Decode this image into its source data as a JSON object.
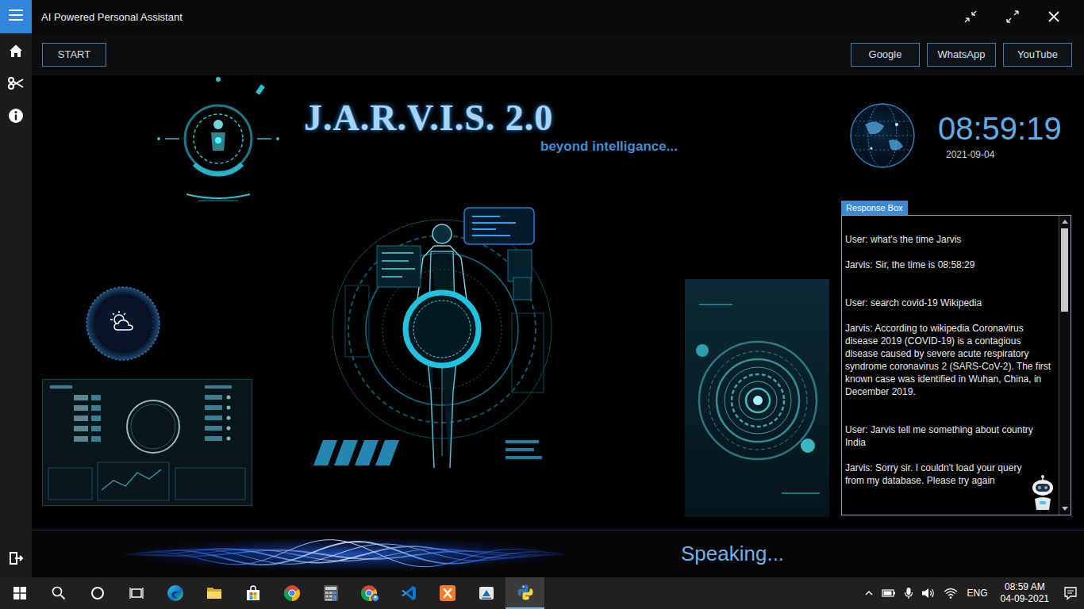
{
  "window": {
    "title": "AI Powered Personal Assistant"
  },
  "toolbar": {
    "start": "START",
    "links": [
      "Google",
      "WhatsApp",
      "YouTube"
    ]
  },
  "header": {
    "title": "J.A.R.V.I.S. 2.0",
    "tagline": "beyond intelligance..."
  },
  "clock": {
    "time": "08:59:19",
    "date": "2021-09-04"
  },
  "response_box": {
    "label": "Response Box",
    "messages": [
      {
        "kind": "user",
        "text": "User: what's the time Jarvis"
      },
      {
        "kind": "jarvis",
        "text": "Jarvis: Sir, the time is 08:58:29"
      },
      {
        "kind": "user",
        "text": "User: search covid-19 Wikipedia"
      },
      {
        "kind": "jarvis",
        "text": "Jarvis: According to wikipedia Coronavirus disease 2019 (COVID-19) is a contagious disease caused by severe acute respiratory syndrome coronavirus 2 (SARS-CoV-2). The first known case was identified in Wuhan, China, in December 2019."
      },
      {
        "kind": "user",
        "text": "User: Jarvis tell me something about country India"
      },
      {
        "kind": "jarvis",
        "text": "Jarvis: Sorry sir. I couldn't load your query from my database. Please try again"
      }
    ]
  },
  "status": {
    "text": "Speaking..."
  },
  "taskbar": {
    "buttons": [
      {
        "kind": "start"
      },
      {
        "kind": "search"
      },
      {
        "kind": "cortana"
      },
      {
        "kind": "taskview"
      }
    ],
    "apps": [
      {
        "kind": "edge",
        "selected": false
      },
      {
        "kind": "explorer",
        "selected": false
      },
      {
        "kind": "store",
        "selected": false
      },
      {
        "kind": "chrome",
        "selected": false
      },
      {
        "kind": "calculator",
        "selected": false
      },
      {
        "kind": "chromeprofile",
        "selected": false
      },
      {
        "kind": "vscode",
        "selected": false
      },
      {
        "kind": "xampp",
        "selected": false
      },
      {
        "kind": "installer",
        "selected": false
      },
      {
        "kind": "python",
        "selected": true
      }
    ],
    "tray": {
      "icons": [
        {
          "kind": "chevron"
        },
        {
          "kind": "battery"
        },
        {
          "kind": "mic"
        },
        {
          "kind": "volume"
        },
        {
          "kind": "wifi"
        }
      ],
      "language": "ENG",
      "time": "08:59 AM",
      "date": "04-09-2021"
    }
  }
}
